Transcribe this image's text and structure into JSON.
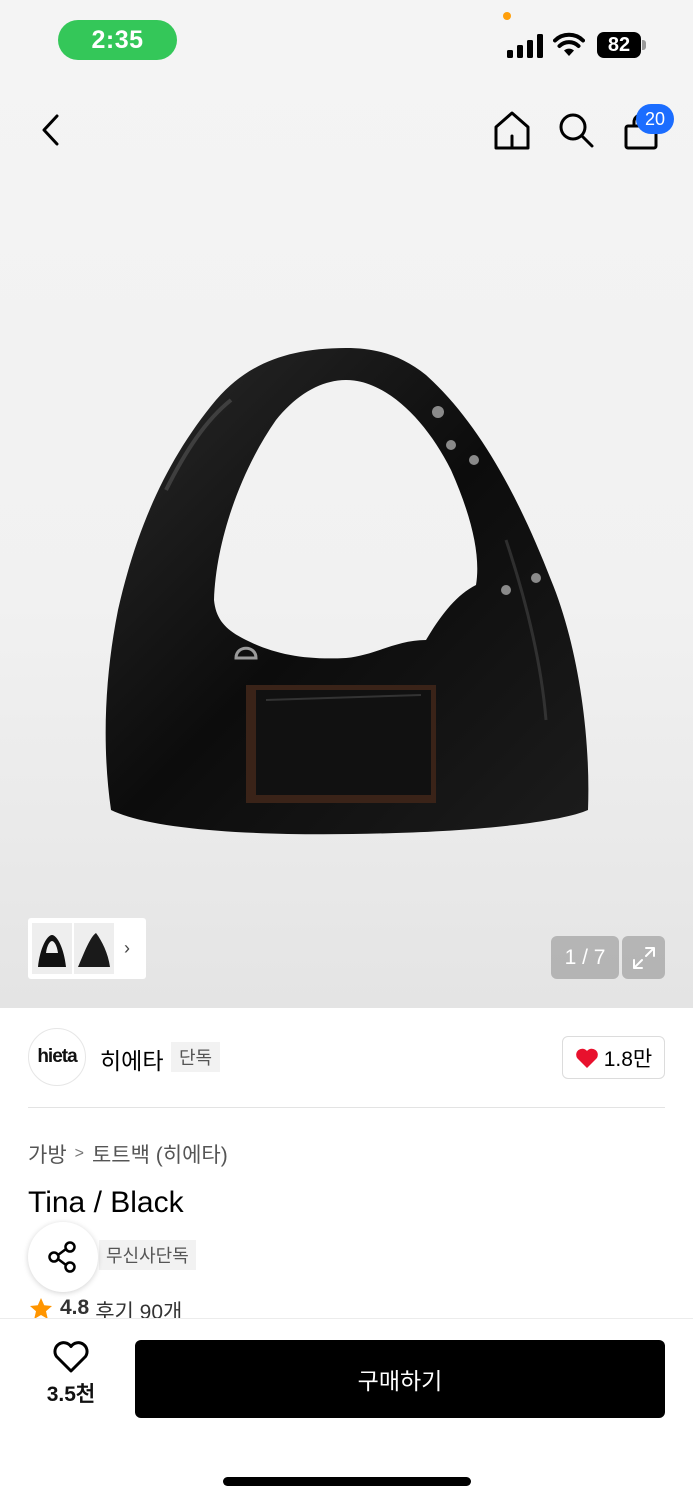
{
  "status_bar": {
    "time": "2:35",
    "battery": "82"
  },
  "nav": {
    "cart_count": "20",
    "icons": [
      "back-chevron-icon",
      "home-icon",
      "search-icon",
      "cart-icon"
    ]
  },
  "gallery": {
    "counter": "1 / 7",
    "thumbnail_more": "›"
  },
  "brand": {
    "logo_text": "hieta",
    "name": "히에타",
    "tag": "단독",
    "likes": "1.8만"
  },
  "breadcrumb": {
    "category": "가방",
    "separator": ">",
    "subcategory": "토트백 (히에타)"
  },
  "product": {
    "title": "Tina / Black",
    "exclusive_badge": "무신사단독",
    "rating": "4.8",
    "reviews": "후기 90개"
  },
  "bottom": {
    "wishlist_count": "3.5천",
    "buy_label": "구매하기"
  },
  "colors": {
    "accent_badge": "#1b6dff",
    "time_pill": "#34c759",
    "heart": "#e8112d",
    "star": "#ff9500"
  }
}
